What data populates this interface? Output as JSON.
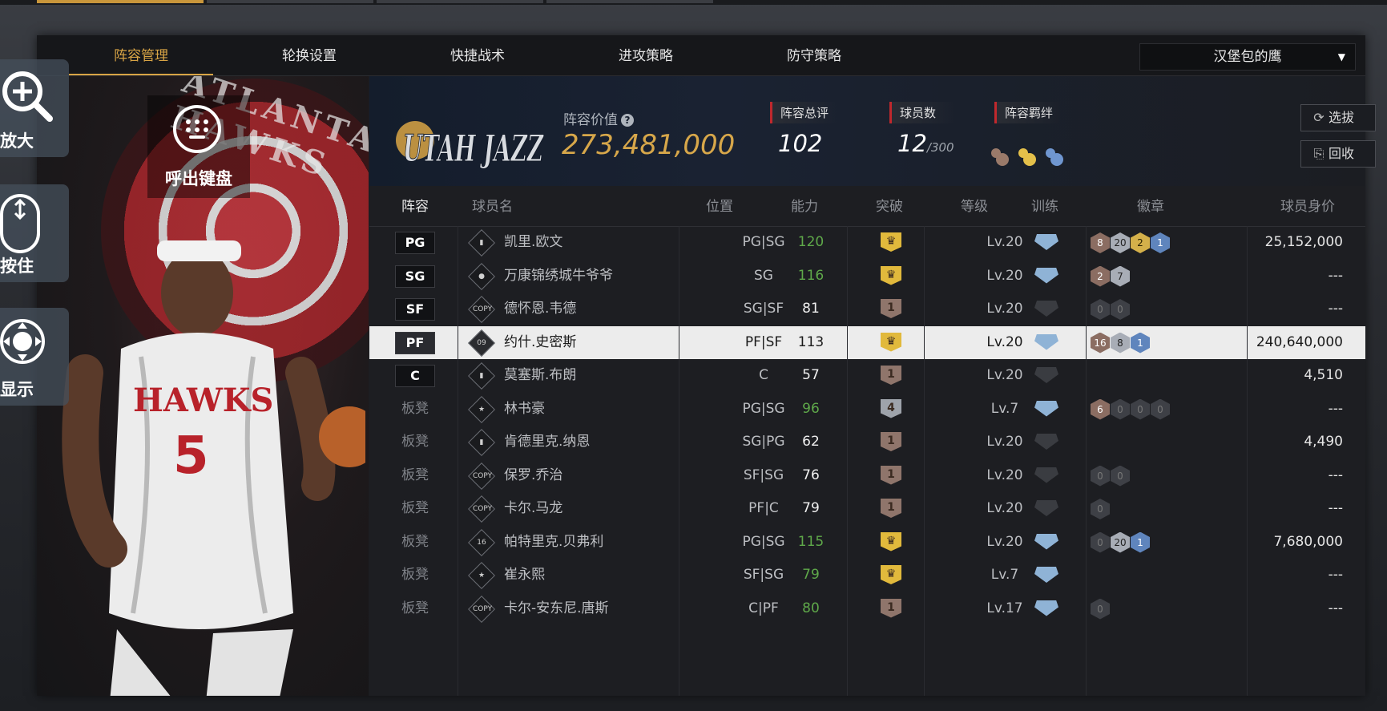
{
  "tabs": [
    {
      "label": "阵容管理",
      "active": true
    },
    {
      "label": "轮换设置",
      "active": false
    },
    {
      "label": "快捷战术",
      "active": false
    },
    {
      "label": "进攻策略",
      "active": false
    },
    {
      "label": "防守策略",
      "active": false
    }
  ],
  "team_selector": {
    "value": "汉堡包的鹰"
  },
  "side_controls": {
    "zoom_label": "放大",
    "hold_label": "按住",
    "display_label": "显示",
    "keyboard_label": "呼出键盘"
  },
  "left_art": {
    "logo_text": "ATLANTA HAWKS",
    "jersey_team": "HAWKS",
    "jersey_number": "5"
  },
  "header": {
    "logo_text": "UTAH JAZZ",
    "value_label": "阵容价值",
    "value": "273,481,000",
    "rating_label": "阵容总评",
    "rating": "102",
    "players_label": "球员数",
    "players_count": "12",
    "players_max": "/300",
    "bond_label": "阵容羁绊",
    "select_button": "选拔",
    "recycle_button": "回收"
  },
  "columns": [
    "阵容",
    "球员名",
    "位置",
    "能力",
    "突破",
    "等级",
    "训练",
    "徽章",
    "球员身价"
  ],
  "colors": {
    "accent": "#d8a445",
    "green": "#5fa94a",
    "red": "#c0282d"
  },
  "players": [
    {
      "slot": "PG",
      "bench": false,
      "type": "bars",
      "name": "凯里.欧文",
      "pos": "PG|SG",
      "ability": "120",
      "ability_color": "green",
      "breakthrough": "gold",
      "brk_text": "",
      "level": "Lv.20",
      "train": true,
      "badges": [
        [
          "b",
          "8"
        ],
        [
          "s",
          "20"
        ],
        [
          "g",
          "2"
        ],
        [
          "h",
          "1"
        ]
      ],
      "value": "25,152,000"
    },
    {
      "slot": "SG",
      "bench": false,
      "type": "person",
      "name": "万康锦绣城牛爷爷",
      "pos": "SG",
      "ability": "116",
      "ability_color": "green",
      "breakthrough": "gold",
      "brk_text": "",
      "level": "Lv.20",
      "train": true,
      "badges": [
        [
          "b",
          "2"
        ],
        [
          "s",
          "7"
        ]
      ],
      "value": "---"
    },
    {
      "slot": "SF",
      "bench": false,
      "type": "COPY",
      "name": "德怀恩.韦德",
      "pos": "SG|SF",
      "ability": "81",
      "ability_color": "white",
      "breakthrough": "bronze",
      "brk_text": "1",
      "level": "Lv.20",
      "train": false,
      "badges": [
        [
          "e",
          "0"
        ],
        [
          "e",
          "0"
        ]
      ],
      "value": "---"
    },
    {
      "slot": "PF",
      "bench": false,
      "type": "09",
      "name": "约什.史密斯",
      "pos": "PF|SF",
      "ability": "113",
      "ability_color": "white",
      "breakthrough": "gold",
      "brk_text": "",
      "level": "Lv.20",
      "train": true,
      "badges": [
        [
          "b",
          "16"
        ],
        [
          "s",
          "8"
        ],
        [
          "h",
          "1"
        ]
      ],
      "value": "240,640,000",
      "selected": true
    },
    {
      "slot": "C",
      "bench": false,
      "type": "bars",
      "name": "莫塞斯.布朗",
      "pos": "C",
      "ability": "57",
      "ability_color": "white",
      "breakthrough": "bronze",
      "brk_text": "1",
      "level": "Lv.20",
      "train": false,
      "badges": [],
      "value": "4,510"
    },
    {
      "slot": "板凳",
      "bench": true,
      "type": "star",
      "name": "林书豪",
      "pos": "PG|SG",
      "ability": "96",
      "ability_color": "green",
      "breakthrough": "silver",
      "brk_text": "4",
      "level": "Lv.7",
      "train": true,
      "badges": [
        [
          "b",
          "6"
        ],
        [
          "e",
          "0"
        ],
        [
          "e",
          "0"
        ],
        [
          "e",
          "0"
        ]
      ],
      "value": "---"
    },
    {
      "slot": "板凳",
      "bench": true,
      "type": "bars",
      "name": "肯德里克.纳恩",
      "pos": "SG|PG",
      "ability": "62",
      "ability_color": "white",
      "breakthrough": "bronze",
      "brk_text": "1",
      "level": "Lv.20",
      "train": false,
      "badges": [],
      "value": "4,490"
    },
    {
      "slot": "板凳",
      "bench": true,
      "type": "COPY",
      "name": "保罗.乔治",
      "pos": "SF|SG",
      "ability": "76",
      "ability_color": "white",
      "breakthrough": "bronze",
      "brk_text": "1",
      "level": "Lv.20",
      "train": false,
      "badges": [
        [
          "e",
          "0"
        ],
        [
          "e",
          "0"
        ]
      ],
      "value": "---"
    },
    {
      "slot": "板凳",
      "bench": true,
      "type": "COPY",
      "name": "卡尔.马龙",
      "pos": "PF|C",
      "ability": "79",
      "ability_color": "white",
      "breakthrough": "bronze",
      "brk_text": "1",
      "level": "Lv.20",
      "train": false,
      "badges": [
        [
          "e",
          "0"
        ]
      ],
      "value": "---"
    },
    {
      "slot": "板凳",
      "bench": true,
      "type": "16",
      "name": "帕特里克.贝弗利",
      "pos": "PG|SG",
      "ability": "115",
      "ability_color": "green",
      "breakthrough": "gold",
      "brk_text": "",
      "level": "Lv.20",
      "train": true,
      "badges": [
        [
          "e",
          "0"
        ],
        [
          "s",
          "20"
        ],
        [
          "h",
          "1"
        ]
      ],
      "value": "7,680,000"
    },
    {
      "slot": "板凳",
      "bench": true,
      "type": "star",
      "name": "崔永熙",
      "pos": "SF|SG",
      "ability": "79",
      "ability_color": "green",
      "breakthrough": "gold",
      "brk_text": "",
      "level": "Lv.7",
      "train": true,
      "badges": [],
      "value": "---"
    },
    {
      "slot": "板凳",
      "bench": true,
      "type": "COPY",
      "name": "卡尔-安东尼.唐斯",
      "pos": "C|PF",
      "ability": "80",
      "ability_color": "green",
      "breakthrough": "bronze",
      "brk_text": "1",
      "level": "Lv.17",
      "train": true,
      "badges": [
        [
          "e",
          "0"
        ]
      ],
      "value": "---"
    }
  ]
}
